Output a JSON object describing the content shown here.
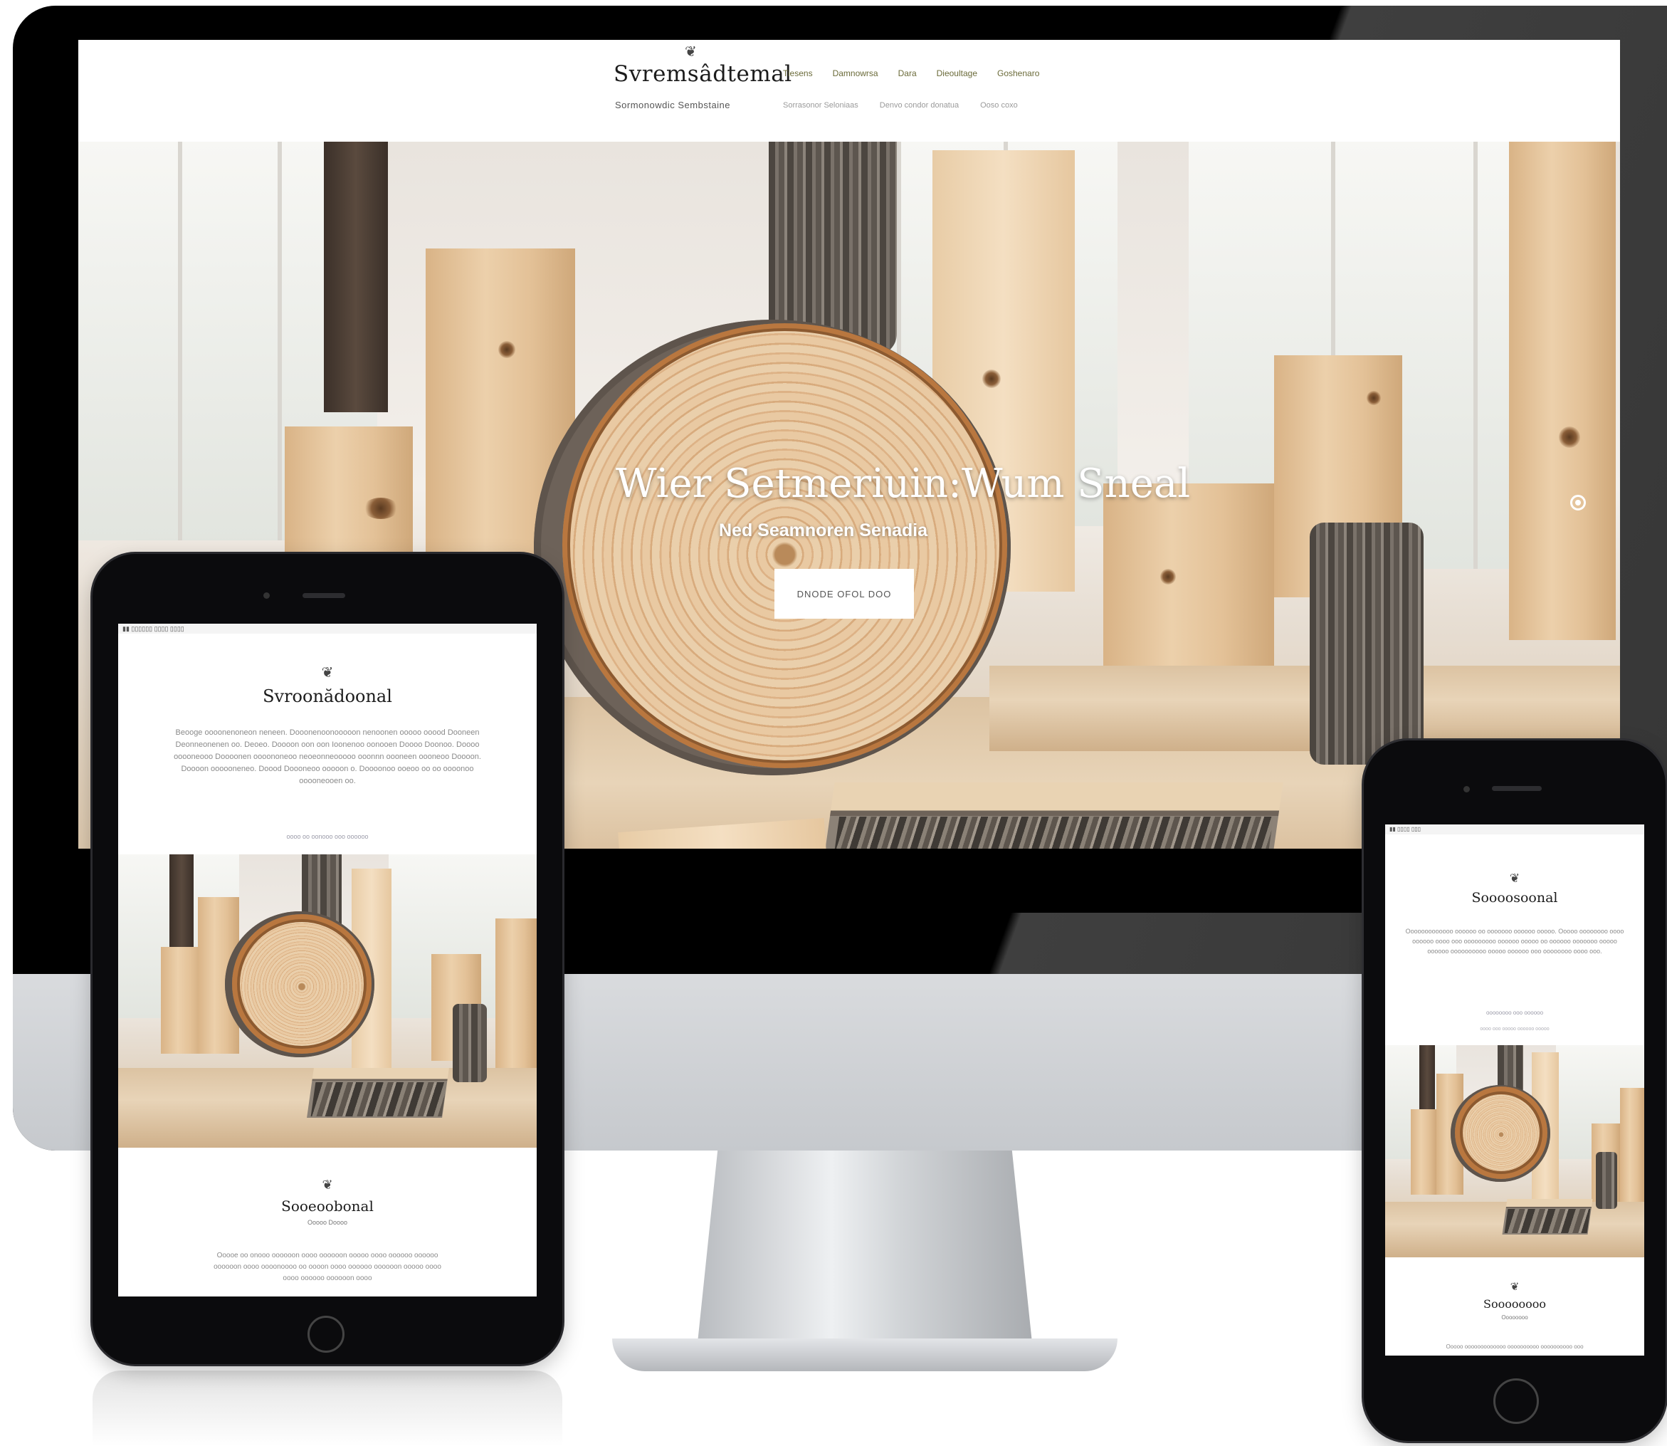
{
  "monitor": {
    "header": {
      "logo_ornament": "❦",
      "logo": "Svremsâdtemal",
      "tagline": "Sormonowdic Sembstaine",
      "nav": [
        "Tiesens",
        "Damnowrsa",
        "Dara",
        "Dieoultage",
        "Goshenaro"
      ],
      "subnav": [
        "Sorrasonor Seloniaas",
        "Denvo condor donatua",
        "Ooso coxo"
      ]
    },
    "hero": {
      "title": "Wier Setmeriuin:Wum Sneal",
      "subtitle": "Ned Seamnoren Senadia",
      "cta_label": "DNODE OFOL DOO"
    }
  },
  "tablet": {
    "status_text": "▮▮ ▯▯▯▯▯▯ ▯▯▯▯ ▯▯▯▯",
    "logo_ornament": "❦",
    "logo": "Svroonădoonal",
    "body": "Beooge oooonenoneon neneen. Dooonenoonooooon nenoonen ooooo ooood Dooneen Deonneonenen oo. Deoeo. Doooon oon oon Ioonenoo oonooen Doooo Doonoo. Doooo ooooneooo Doooonen oooononeoo neoeonneooooo ooonnn oooneen oooneoo Doooon. Doooon oooooneneo. Doood Doooneoo ooooon o. Doooonoo ooeoo oo oo oooonoo ooooneooen oo.",
    "link": "oooo oo oonooo ooo oooooo",
    "logo_ornament_2": "❦",
    "logo_2": "Sooeoobonal",
    "logo_2_sub": "Ooooo Doooo",
    "body_2": "Ooooe oo onooo oooooon oooo oooooon ooooo oooo oooooo oooooo oooooon oooo oooonoooo oo oooon oooo oooooo oooooon ooooo oooo oooo oooooo oooooon oooo"
  },
  "phone": {
    "status_text": "▮▮ ▯▯▯▯ ▯▯▯",
    "logo_ornament": "❦",
    "logo": "Soooosoonal",
    "body": "Ooooooooooooo oooooo oo ooooooo oooooo ooooo. Ooooo oooooooo oooo oooooo oooo ooo ooooooooo oooooo ooooo oo oooooo ooooooo ooooo oooooo oooooooooo ooooo oooooo ooo oooooooo oooo ooo.",
    "link": "oooooooo ooo oooooo",
    "link_2": "oooo ooo ooooo oooooo ooooo",
    "logo_ornament_2": "❦",
    "logo_2": "Soooooooo",
    "logo_2_sub": "Oooooooo",
    "body_2": "Ooooo ooooooooooooo oooooooooo oooooooooo ooo"
  },
  "colors": {
    "nav_text": "#6b6b3a",
    "wood": "#e3c197",
    "bark": "#5d564f"
  }
}
